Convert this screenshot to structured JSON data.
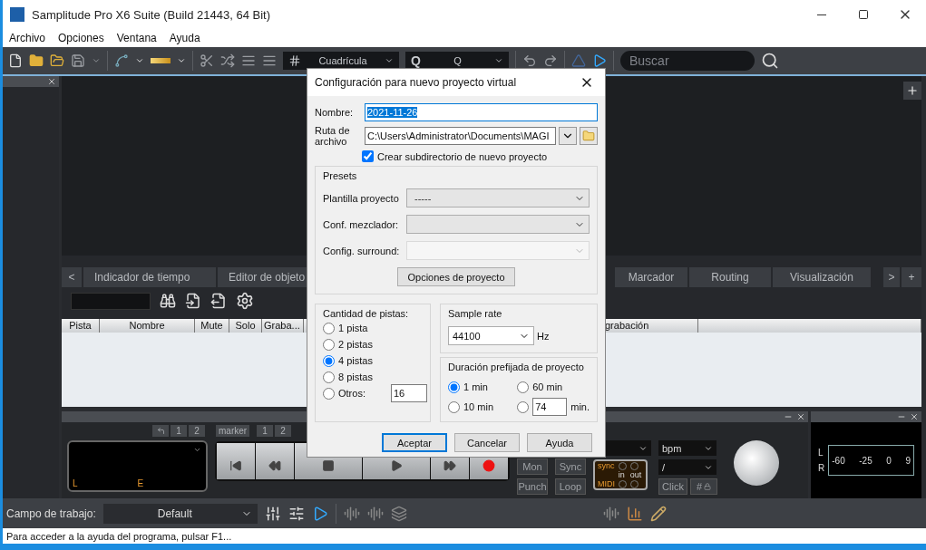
{
  "window": {
    "title": "Samplitude Pro X6 Suite (Build 21443, 64 Bit)"
  },
  "menu": [
    "Archivo",
    "Opciones",
    "Ventana",
    "Ayuda"
  ],
  "toolbar": {
    "grid_select": "Cuadrícula",
    "q_label": "Q",
    "q_select": "Q",
    "search": {
      "placeholder": "Buscar"
    }
  },
  "manager": {
    "prev": "<",
    "next": ">",
    "add": "+",
    "tabs": [
      {
        "label": "Indicador de tiempo",
        "selected": false
      },
      {
        "label": "Editor de objeto",
        "selected": false
      },
      {
        "label": "Marcador",
        "selected": false
      },
      {
        "label": "Routing",
        "selected": false
      },
      {
        "label": "Visualización",
        "selected": false
      }
    ],
    "columns": [
      "Pista",
      "Nombre",
      "Mute",
      "Solo",
      "Graba...",
      "grabación"
    ]
  },
  "transport": {
    "marker_buttons": [
      "1",
      "2"
    ],
    "marker_label": "marker",
    "marker_numbers": [
      "1",
      "2"
    ],
    "display": [
      "L",
      "E"
    ],
    "mode_buttons": [
      "Mon",
      "Sync",
      "Punch",
      "Loop"
    ],
    "tempo_unit": "bpm",
    "signature": "/",
    "sync": "sync",
    "midi": "MIDI",
    "in": "in",
    "out": "out",
    "click": "Click",
    "hash": "#"
  },
  "meter": {
    "channels": [
      "L",
      "R"
    ],
    "scale": [
      "-60",
      "-25",
      "0",
      "9"
    ]
  },
  "workspace": {
    "label": "Campo de trabajo:",
    "value": "Default"
  },
  "status_bar": "Para acceder a la ayuda del programa, pulsar F1...",
  "dialog": {
    "title": "Configuración para nuevo proyecto virtual",
    "name": {
      "label": "Nombre:",
      "value": "2021-11-26"
    },
    "path": {
      "label": "Ruta de archivo",
      "value": "C:\\Users\\Administrator\\Documents\\MAGI"
    },
    "subdir": {
      "label": "Crear subdirectorio de nuevo proyecto",
      "checked": true
    },
    "presets": {
      "title": "Presets",
      "options_button": "Opciones de proyecto",
      "rows": [
        {
          "label": "Plantilla proyecto",
          "value": "-----",
          "disabled": false
        },
        {
          "label": "Conf. mezclador:",
          "disabled": false
        },
        {
          "label": "Config. surround:",
          "disabled": true
        }
      ]
    },
    "tracks": {
      "title": "Cantidad de pistas:",
      "options": [
        {
          "kind": "preset",
          "label": "1 pista",
          "selected": false
        },
        {
          "kind": "preset",
          "label": "2 pistas",
          "selected": false
        },
        {
          "kind": "preset",
          "label": "4 pistas",
          "selected": true
        },
        {
          "kind": "preset",
          "label": "8 pistas",
          "selected": false
        },
        {
          "kind": "other",
          "label": "Otros:",
          "value": "16",
          "selected": false
        }
      ]
    },
    "sample_rate": {
      "title": "Sample rate",
      "value": "44100",
      "unit": "Hz"
    },
    "duration": {
      "title": "Duración prefijada de proyecto",
      "options": [
        {
          "kind": "preset",
          "label": "1 min",
          "selected": true
        },
        {
          "kind": "preset",
          "label": "60 min",
          "selected": false
        },
        {
          "kind": "preset",
          "label": "10 min",
          "selected": false
        },
        {
          "kind": "custom",
          "value": "74",
          "label": "min.",
          "selected": false
        }
      ]
    },
    "buttons": [
      {
        "label": "Aceptar",
        "default": true
      },
      {
        "label": "Cancelar",
        "default": false
      },
      {
        "label": "Ayuda",
        "default": false
      }
    ]
  }
}
